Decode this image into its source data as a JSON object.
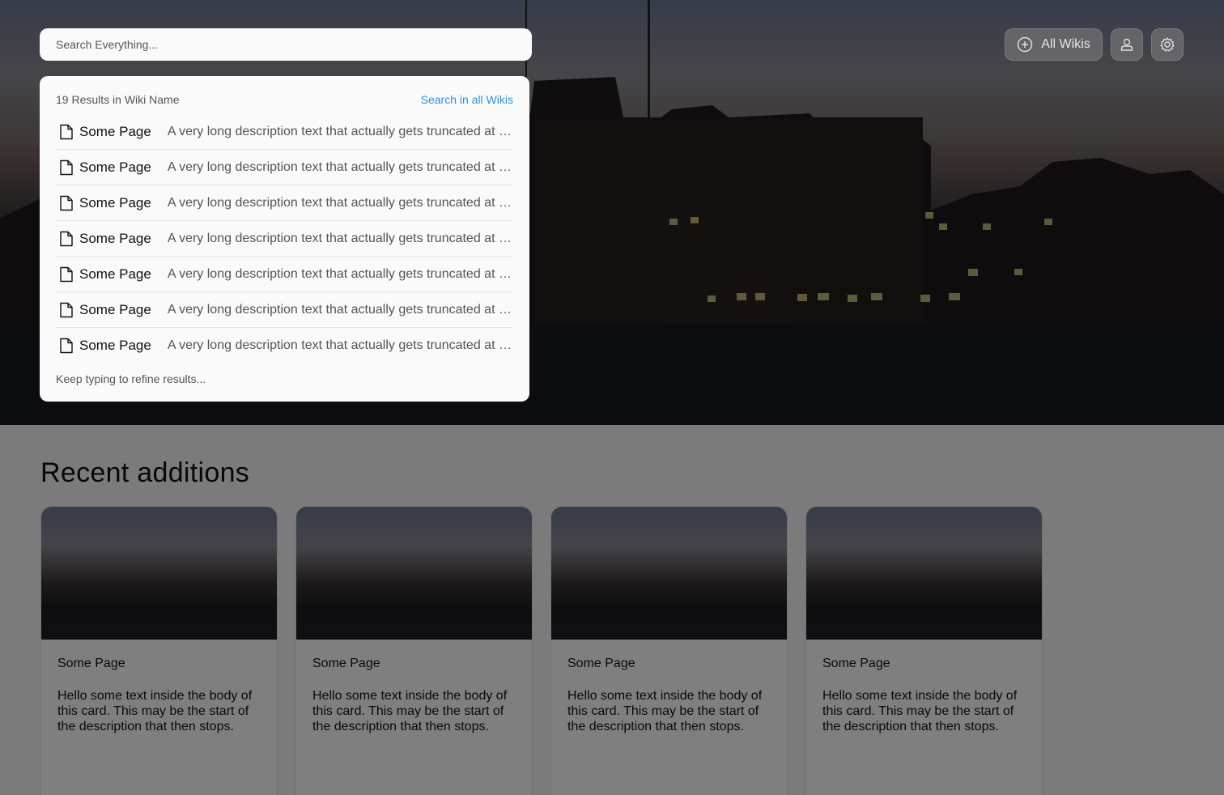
{
  "search": {
    "placeholder": "Search Everything..."
  },
  "header_buttons": {
    "all_wikis_label": "All Wikis",
    "icons": [
      "plus-circle-icon",
      "user-icon",
      "gear-icon"
    ]
  },
  "results": {
    "count_text": "19 Results in Wiki Name",
    "search_all_label": "Search in all Wikis",
    "items": [
      {
        "title": "Some Page",
        "description": "A very long description text that actually gets truncated at some point"
      },
      {
        "title": "Some Page",
        "description": "A very long description text that actually gets truncated at some point"
      },
      {
        "title": "Some Page",
        "description": "A very long description text that actually gets truncated at some point"
      },
      {
        "title": "Some Page",
        "description": "A very long description text that actually gets truncated at some point"
      },
      {
        "title": "Some Page",
        "description": "A very long description text that actually gets truncated at some point"
      },
      {
        "title": "Some Page",
        "description": "A very long description text that actually gets truncated at some point"
      },
      {
        "title": "Some Page",
        "description": "A very long description text that actually gets truncated at some point"
      }
    ],
    "footer_hint": "Keep typing to refine results..."
  },
  "recent": {
    "title": "Recent additions",
    "cards": [
      {
        "title": "Some Page",
        "body": "Hello some text inside the body of this card. This may be the start of the description that then stops."
      },
      {
        "title": "Some Page",
        "body": "Hello some text inside the body of this card. This may be the start of the description that then stops."
      },
      {
        "title": "Some Page",
        "body": "Hello some text inside the body of this card. This may be the start of the description that then stops."
      },
      {
        "title": "Some Page",
        "body": "Hello some text inside the body of this card. This may be the start of the description that then stops."
      }
    ]
  },
  "colors": {
    "accent_link": "#2d8fd6",
    "overlay": "rgba(0,0,0,0.5)"
  }
}
